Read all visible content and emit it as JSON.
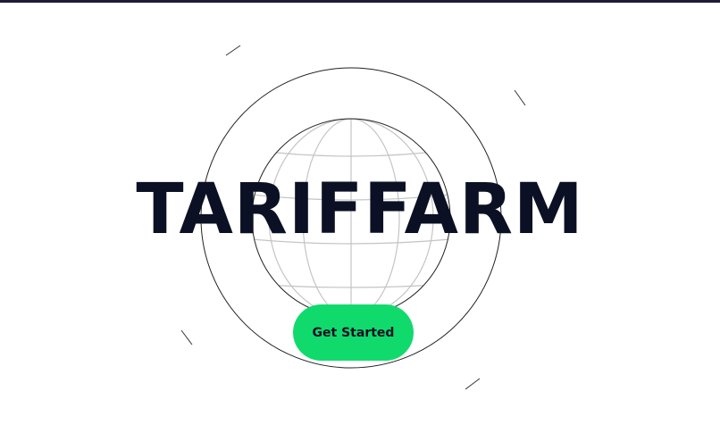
{
  "brand": {
    "title": "TARIFFARM"
  },
  "hero": {
    "cta_label": "Get Started"
  },
  "colors": {
    "top_bar": "#1e1b3a",
    "title_text": "#0c1024",
    "cta_background": "#11da6d",
    "outer_ring": "#222222",
    "globe_grid": "#c4c4c4"
  },
  "icons": {
    "hero": "globe-icon"
  }
}
